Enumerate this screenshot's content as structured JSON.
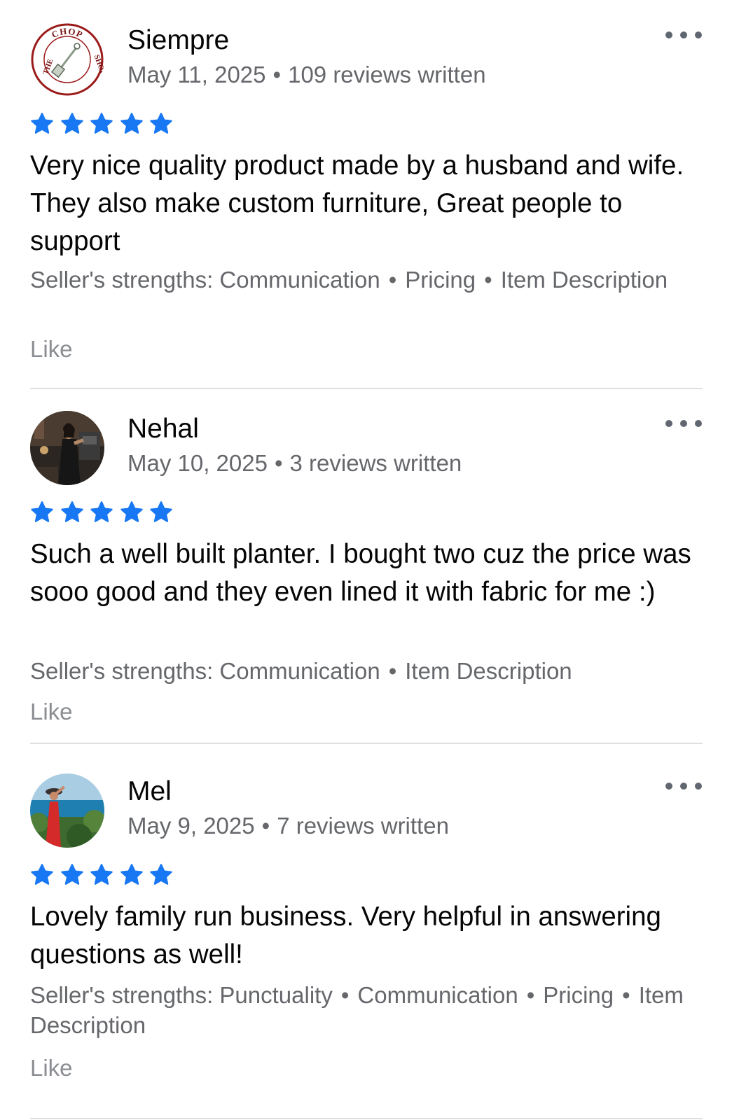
{
  "colors": {
    "star": "#1877f2",
    "meta": "#65676b",
    "like": "#8a8d91",
    "divider": "#dddfe2"
  },
  "reviews": [
    {
      "name": "Siempre",
      "date": "May 11, 2025",
      "reviews_written": "109 reviews written",
      "rating": 5,
      "avatar_icon": "the-chop-shop-logo",
      "avatar_logo_text": [
        "THE",
        "CHOP",
        "SHOP"
      ],
      "text": "Very nice quality product made by a husband and wife.  They also make custom furniture, Great people to support",
      "strengths_label": "Seller's strengths:",
      "strengths": [
        "Communication",
        "Pricing",
        "Item Description"
      ],
      "like": "Like"
    },
    {
      "name": "Nehal",
      "date": "May 10, 2025",
      "reviews_written": "3 reviews written",
      "rating": 5,
      "avatar_icon": "profile-photo",
      "text": "Such a well built planter. I bought two cuz the price was sooo good and they even lined it with fabric for me :)",
      "strengths_label": "Seller's strengths:",
      "strengths": [
        "Communication",
        "Item Description"
      ],
      "like": "Like"
    },
    {
      "name": "Mel",
      "date": "May 9, 2025",
      "reviews_written": "7 reviews written",
      "rating": 5,
      "avatar_icon": "profile-photo",
      "text": "Lovely family run business. Very helpful in answering questions as well!",
      "strengths_label": "Seller's strengths:",
      "strengths": [
        "Punctuality",
        "Communication",
        "Pricing",
        "Item Description"
      ],
      "like": "Like"
    }
  ]
}
